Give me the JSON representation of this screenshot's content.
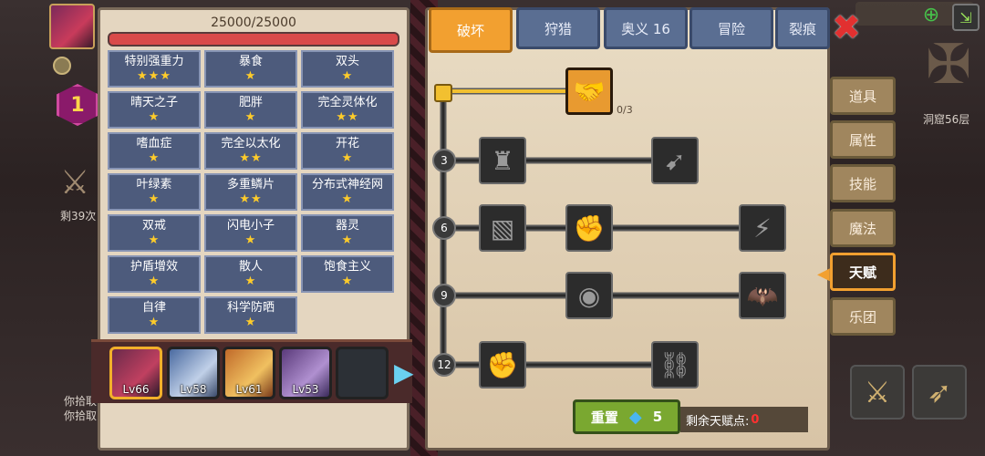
{
  "hud": {
    "remaining": "剩39次",
    "log_line1": "你拾取",
    "log_line2": "你拾取",
    "badge_level": "1",
    "cave_label": "洞窟56层"
  },
  "traits_panel": {
    "hp": "25000/25000",
    "traits": [
      {
        "name": "特别强重力",
        "stars": "★★★"
      },
      {
        "name": "暴食",
        "stars": "★"
      },
      {
        "name": "双头",
        "stars": "★"
      },
      {
        "name": "晴天之子",
        "stars": "★"
      },
      {
        "name": "肥胖",
        "stars": "★"
      },
      {
        "name": "完全灵体化",
        "stars": "★★"
      },
      {
        "name": "嗜血症",
        "stars": "★"
      },
      {
        "name": "完全以太化",
        "stars": "★★"
      },
      {
        "name": "开花",
        "stars": "★"
      },
      {
        "name": "叶绿素",
        "stars": "★"
      },
      {
        "name": "多重鳞片",
        "stars": "★★"
      },
      {
        "name": "分布式神经网",
        "stars": "★"
      },
      {
        "name": "双戒",
        "stars": "★"
      },
      {
        "name": "闪电小子",
        "stars": "★"
      },
      {
        "name": "器灵",
        "stars": "★"
      },
      {
        "name": "护盾增效",
        "stars": "★"
      },
      {
        "name": "散人",
        "stars": "★"
      },
      {
        "name": "饱食主义",
        "stars": "★"
      },
      {
        "name": "自律",
        "stars": "★"
      },
      {
        "name": "科学防晒",
        "stars": "★"
      }
    ]
  },
  "heroes": [
    {
      "lv": "Lv66"
    },
    {
      "lv": "Lv58"
    },
    {
      "lv": "Lv61"
    },
    {
      "lv": "Lv53"
    }
  ],
  "tabs": [
    "破坏",
    "狩猎",
    "奥义 16",
    "冒险",
    "裂痕"
  ],
  "side_tabs": [
    "道具",
    "属性",
    "技能",
    "魔法",
    "天赋",
    "乐团"
  ],
  "talent": {
    "top_node_count": "0/3",
    "levels": [
      "3",
      "6",
      "9",
      "12"
    ],
    "reset_label": "重置",
    "reset_cost": "5",
    "remaining_label": "剩余天赋点:",
    "remaining_value": "0"
  },
  "colors": {
    "active_tab": "#f2a030",
    "tab": "#5a6e92",
    "trait_cell": "#4d5b7c",
    "star": "#ffcc2a",
    "reset": "#7aa830"
  }
}
